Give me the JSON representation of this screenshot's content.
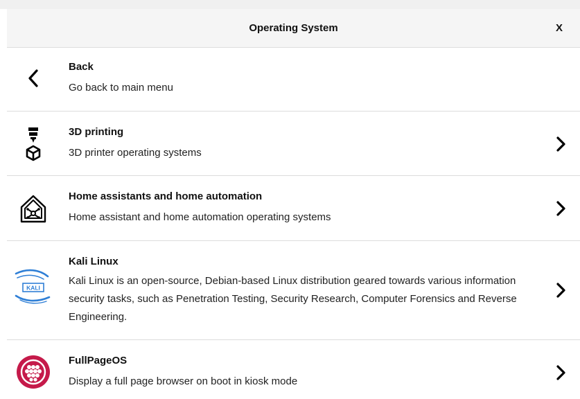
{
  "dialog": {
    "title": "Operating System",
    "close_label": "X"
  },
  "items": [
    {
      "name": "Back",
      "description": "Go back to main menu",
      "icon": "back-chevron-icon",
      "has_submenu": false
    },
    {
      "name": "3D printing",
      "description": "3D printer operating systems",
      "icon": "3d-printer-icon",
      "has_submenu": true
    },
    {
      "name": "Home assistants and home automation",
      "description": "Home assistant and home automation operating systems",
      "icon": "smart-home-icon",
      "has_submenu": true
    },
    {
      "name": "Kali Linux",
      "description": "Kali Linux is an open-source, Debian-based Linux distribution geared towards various information security tasks, such as Penetration Testing, Security Research, Computer Forensics and Reverse Engineering.",
      "icon": "kali-linux-logo",
      "logo_text": "KALI",
      "has_submenu": true
    },
    {
      "name": "FullPageOS",
      "description": "Display a full page browser on boot in kiosk mode",
      "icon": "fullpageos-logo",
      "has_submenu": true
    }
  ],
  "colors": {
    "header_bg": "#f5f5f5",
    "divider": "#dcdcdc",
    "kali_blue": "#2f7fd6",
    "fullpageos_red": "#c51a4a"
  }
}
